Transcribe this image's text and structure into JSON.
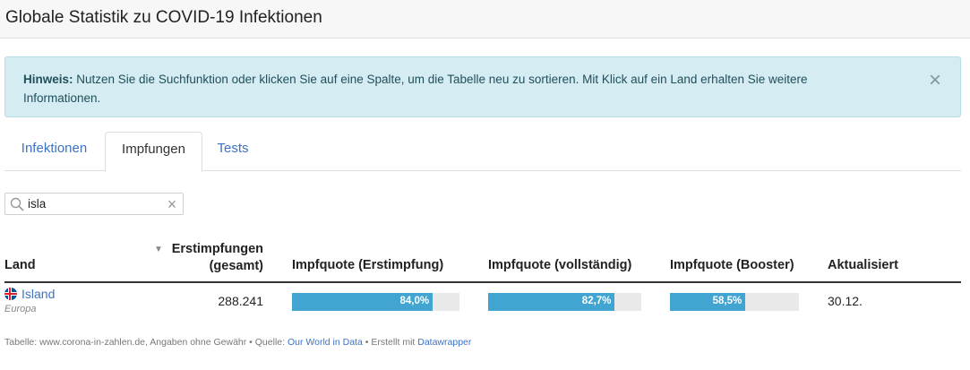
{
  "page": {
    "title": "Globale Statistik zu COVID-19 Infektionen"
  },
  "notice": {
    "label": "Hinweis:",
    "text": " Nutzen Sie die Suchfunktion oder klicken Sie auf eine Spalte, um die Tabelle neu zu sortieren. Mit Klick auf ein Land erhalten Sie weitere Informationen.",
    "close_glyph": "×"
  },
  "tabs": [
    {
      "label": "Infektionen",
      "active": false
    },
    {
      "label": "Impfungen",
      "active": true
    },
    {
      "label": "Tests",
      "active": false
    }
  ],
  "search": {
    "value": "isla",
    "clear_glyph": "×",
    "icon": "search-icon"
  },
  "table": {
    "columns": {
      "land": "Land",
      "erst_line1": "Erstimpfungen",
      "erst_line2": "(gesamt)",
      "sort_glyph": "▼",
      "q1": "Impfquote (Erstimpfung)",
      "q2": "Impfquote (vollständig)",
      "q3": "Impfquote (Booster)",
      "akt": "Aktualisiert"
    },
    "rows": [
      {
        "country": "Island",
        "region": "Europa",
        "flag_icon": "iceland-flag-icon",
        "erstimpfungen": "288.241",
        "q1": {
          "label": "84,0%",
          "value": 84.0
        },
        "q2": {
          "label": "82,7%",
          "value": 82.7
        },
        "q3": {
          "label": "58,5%",
          "value": 58.5
        },
        "updated": "30.12."
      }
    ]
  },
  "footer": {
    "prefix": "Tabelle: www.corona-in-zahlen.de, Angaben ohne Gewähr • Quelle: ",
    "source": "Our World in Data",
    "middle": " • Erstellt mit ",
    "tool": "Datawrapper"
  },
  "colors": {
    "bar": "#42a4d1",
    "bar_bg": "#e9e9e9",
    "link": "#3d72c4",
    "alert_bg": "#d4ecf2"
  }
}
